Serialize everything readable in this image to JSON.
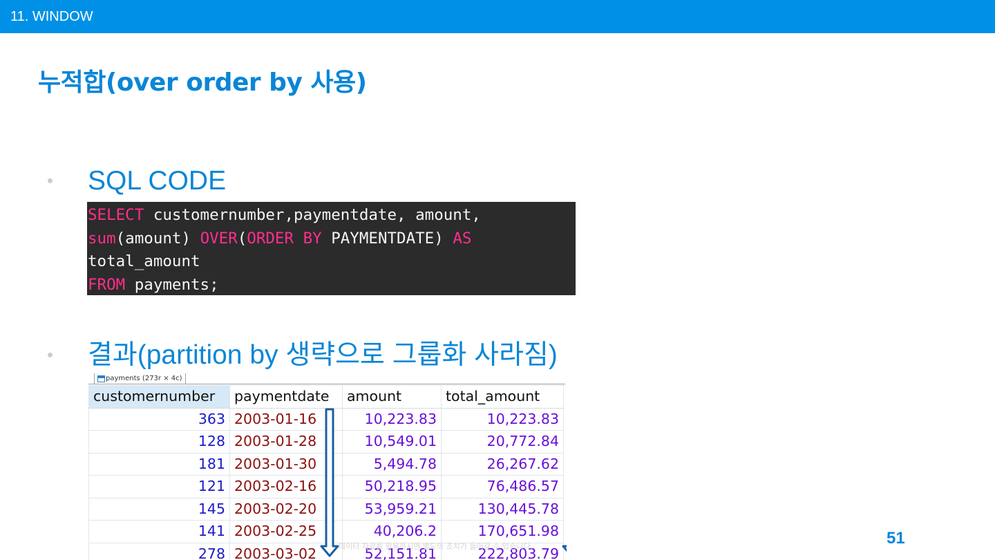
{
  "header": {
    "section": "11. WINDOW"
  },
  "title": "누적합(over order by 사용)",
  "bullets": [
    {
      "text": "SQL CODE"
    },
    {
      "text": "결과(partition by 생략으로 그룹화 사라짐)"
    }
  ],
  "code": {
    "lines": [
      [
        {
          "t": "SELECT",
          "kw": true
        },
        {
          "t": " customernumber,paymentdate, amount,",
          "kw": false
        }
      ],
      [
        {
          "t": "sum",
          "kw": true
        },
        {
          "t": "(amount) ",
          "kw": false
        },
        {
          "t": "OVER",
          "kw": true
        },
        {
          "t": "(",
          "kw": false
        },
        {
          "t": "ORDER BY",
          "kw": true
        },
        {
          "t": " PAYMENTDATE) ",
          "kw": false
        },
        {
          "t": "AS",
          "kw": true
        }
      ],
      [
        {
          "t": "total_amount",
          "kw": false
        }
      ],
      [
        {
          "t": "FROM",
          "kw": true
        },
        {
          "t": " payments;",
          "kw": false
        }
      ]
    ]
  },
  "result_grid": {
    "tab_label": "payments (273r × 4c)",
    "columns": [
      "customernumber",
      "paymentdate",
      "amount",
      "total_amount"
    ],
    "rows": [
      [
        "363",
        "2003-01-16",
        "10,223.83",
        "10,223.83"
      ],
      [
        "128",
        "2003-01-28",
        "10,549.01",
        "20,772.84"
      ],
      [
        "181",
        "2003-01-30",
        "5,494.78",
        "26,267.62"
      ],
      [
        "121",
        "2003-02-16",
        "50,218.95",
        "76,486.57"
      ],
      [
        "145",
        "2003-02-20",
        "53,959.21",
        "130,445.78"
      ],
      [
        "141",
        "2003-02-25",
        "40,206.2",
        "170,651.98"
      ],
      [
        "278",
        "2003-03-02",
        "52,151.81",
        "222,803.79"
      ]
    ],
    "colors": {
      "number": "#1a1ac8",
      "date": "#8b1010",
      "amount": "#6a10d8",
      "arrow": "#1a5fa0"
    }
  },
  "footer": {
    "note": "데이터 자료를 활용하시면 별도의 조치가 들어갈 수 있습니다.",
    "page_number": "51"
  }
}
